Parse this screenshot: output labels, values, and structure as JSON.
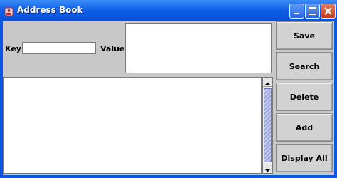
{
  "window": {
    "title": "Address Book"
  },
  "form": {
    "key_label": "Key",
    "key_value": "",
    "value_label": "Value",
    "value_text": ""
  },
  "list": {
    "text": ""
  },
  "buttons": {
    "save": "Save",
    "search": "Search",
    "delete": "Delete",
    "add": "Add",
    "display_all": "Display All"
  },
  "colors": {
    "titlebar": "#0850D8",
    "panel": "#C8C8C8",
    "close": "#C33B1D"
  }
}
